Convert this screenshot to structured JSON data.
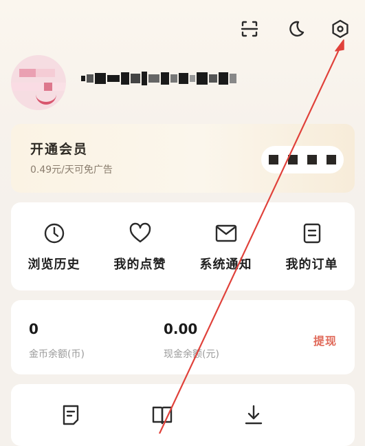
{
  "header": {
    "icons": [
      "scan-icon",
      "moon-icon",
      "settings-icon"
    ]
  },
  "vip": {
    "title": "开通会员",
    "subtitle": "0.49元/天可免广告"
  },
  "quick_links": [
    {
      "label": "浏览历史",
      "icon": "clock-icon"
    },
    {
      "label": "我的点赞",
      "icon": "heart-icon"
    },
    {
      "label": "系统通知",
      "icon": "mail-icon"
    },
    {
      "label": "我的订单",
      "icon": "order-icon"
    }
  ],
  "wallet": {
    "coins_value": "0",
    "coins_label": "金币余额(币)",
    "cash_value": "0.00",
    "cash_label": "现金余额(元)",
    "withdraw_label": "提现"
  },
  "tools": {
    "icons": [
      "note-icon",
      "book-icon",
      "download-icon"
    ]
  },
  "colors": {
    "accent_red": "#e06a5a",
    "annotation_arrow": "#e0413a"
  }
}
